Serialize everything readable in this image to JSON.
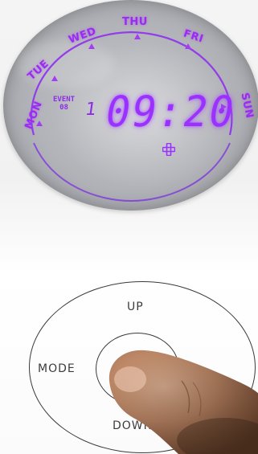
{
  "display": {
    "days": {
      "mon": "MON",
      "tue": "TUE",
      "wed": "WED",
      "thu": "THU",
      "fri": "FRI",
      "sun": "SUN"
    },
    "event_label": "EVENT",
    "event_sub": "08",
    "event_number": "1",
    "time": "09:20",
    "segment_color": "#9b30ff",
    "plus_icon": "plus-icon"
  },
  "controls": {
    "up_label": "UP",
    "mode_label": "MODE",
    "down_label": "DOWN"
  }
}
